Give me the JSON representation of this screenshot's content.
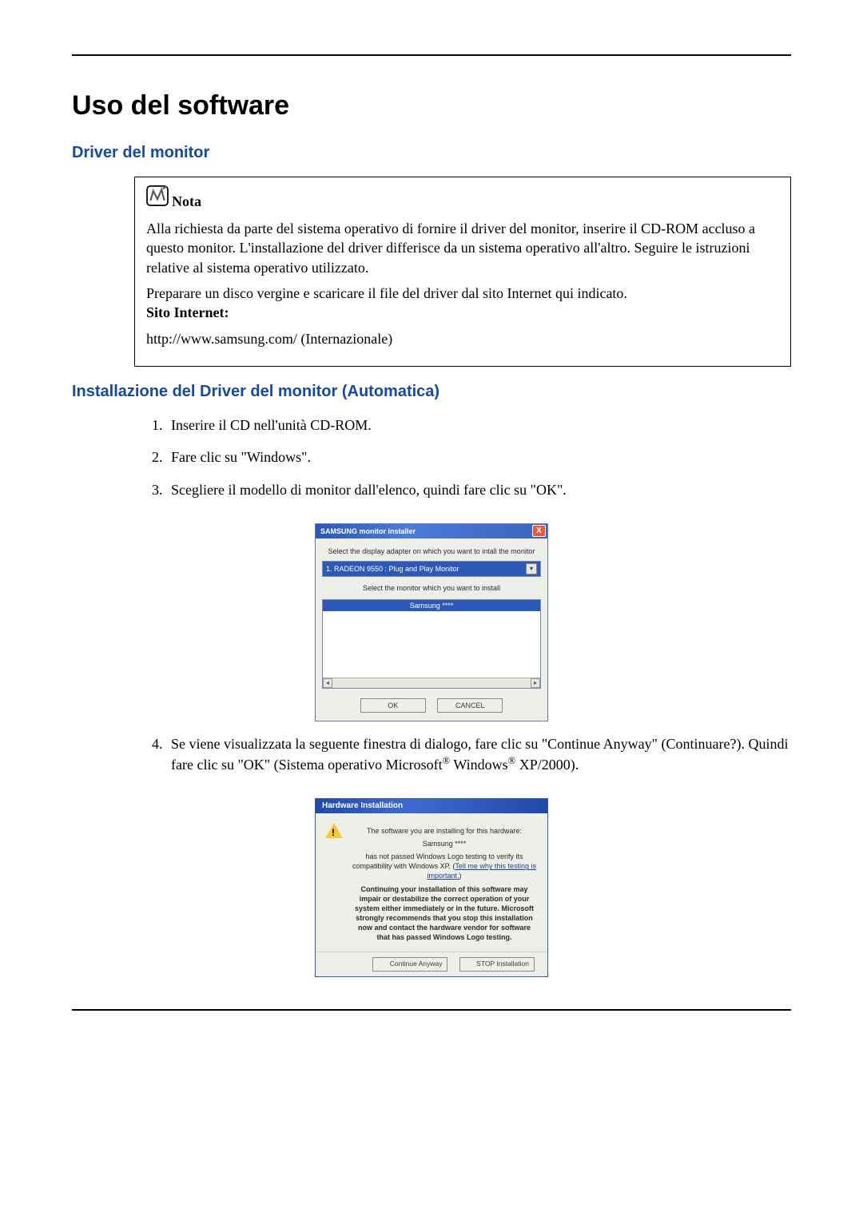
{
  "page": {
    "title": "Uso del software",
    "section1": "Driver del monitor",
    "section2": "Installazione del Driver del monitor (Automatica)"
  },
  "note": {
    "label": "Nota",
    "para1": "Alla richiesta da parte del sistema operativo di fornire il driver del monitor, inserire il CD-ROM accluso a questo monitor. L'installazione del driver differisce da un sistema operativo all'altro. Seguire le istruzioni relative al sistema operativo utilizzato.",
    "para2": "Preparare un disco vergine e scaricare il file del driver dal sito Internet qui indicato.",
    "site_label": "Sito Internet:",
    "site_url": "http://www.samsung.com/ (Internazionale)"
  },
  "steps": {
    "s1": "Inserire il CD nell'unità CD-ROM.",
    "s2": "Fare clic su \"Windows\".",
    "s3": "Scegliere il modello di monitor dall'elenco, quindi fare clic su \"OK\".",
    "s4a": "Se viene visualizzata la seguente finestra di dialogo, fare clic su \"Continue Anyway\" (Continuare?). Quindi fare clic su \"OK\" (Sistema operativo Microsoft",
    "s4b": " Windows",
    "s4c": " XP/2000)."
  },
  "dlg1": {
    "title": "SAMSUNG monitor installer",
    "close": "X",
    "instr1": "Select the display adapter on which you want to intall the monitor",
    "combo": "1. RADEON 9550 : Plug and Play Monitor",
    "instr2": "Select the monitor which you want to install",
    "selected": "Samsung ****",
    "ok": "OK",
    "cancel": "CANCEL"
  },
  "dlg2": {
    "title": "Hardware Installation",
    "line1": "The software you are installing for this hardware:",
    "device": "Samsung ****",
    "line2a": "has not passed Windows Logo testing to verify its compatibility with Windows XP. (",
    "link": "Tell me why this testing is important.",
    "line2b": ")",
    "bold": "Continuing your installation of this software may impair or destabilize the correct operation of your system either immediately or in the future. Microsoft strongly recommends that you stop this installation now and contact the hardware vendor for software that has passed Windows Logo testing.",
    "btn_continue": "Continue Anyway",
    "btn_stop": "STOP Installation"
  }
}
